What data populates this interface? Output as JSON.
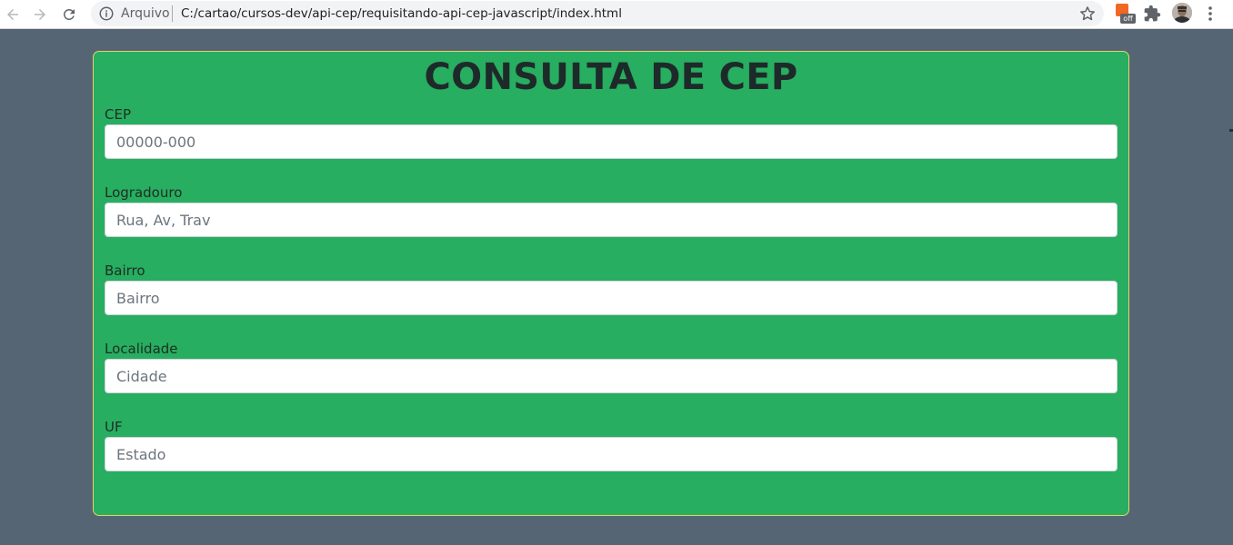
{
  "browser": {
    "origin_label": "Arquivo",
    "url": "C:/cartao/cursos-dev/api-cep/requisitando-api-cep-javascript/index.html",
    "extension_badge": "off",
    "icons": [
      "back-icon",
      "forward-icon",
      "reload-icon",
      "info-icon",
      "star-icon",
      "extension-icon",
      "puzzle-icon",
      "profile-avatar",
      "menu-icon"
    ]
  },
  "page": {
    "title": "CONSULTA DE CEP",
    "fields": [
      {
        "label": "CEP",
        "placeholder": "00000-000",
        "value": ""
      },
      {
        "label": "Logradouro",
        "placeholder": "Rua, Av, Trav",
        "value": ""
      },
      {
        "label": "Bairro",
        "placeholder": "Bairro",
        "value": ""
      },
      {
        "label": "Localidade",
        "placeholder": "Cidade",
        "value": ""
      },
      {
        "label": "UF",
        "placeholder": "Estado",
        "value": ""
      }
    ]
  },
  "colors": {
    "page_background": "#566573",
    "card_background": "#27ae60",
    "card_border": "#e6d36a",
    "title_color": "#1e2a2a"
  }
}
